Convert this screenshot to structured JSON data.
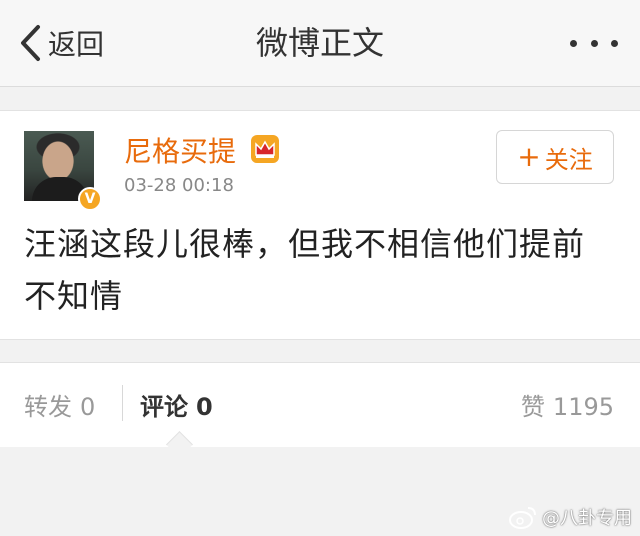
{
  "nav": {
    "back_label": "返回",
    "title": "微博正文"
  },
  "post": {
    "author": "尼格买提",
    "time": "03-28 00:18",
    "follow_label": "关注",
    "text": "汪涵这段儿很棒，但我不相信他们提前不知情",
    "verified_badge": "V"
  },
  "tabs": {
    "repost_label": "转发",
    "repost_count": "0",
    "comment_label": "评论",
    "comment_count": "0",
    "like_label": "赞",
    "like_count": "1195"
  },
  "watermark": {
    "text": "@八卦专用"
  },
  "colors": {
    "accent": "#e86b0c",
    "badge": "#f5a623",
    "background": "#f2f2f2"
  },
  "icons": [
    "back-chevron-icon",
    "more-icon",
    "crown-icon",
    "verified-icon",
    "weibo-logo-icon"
  ]
}
